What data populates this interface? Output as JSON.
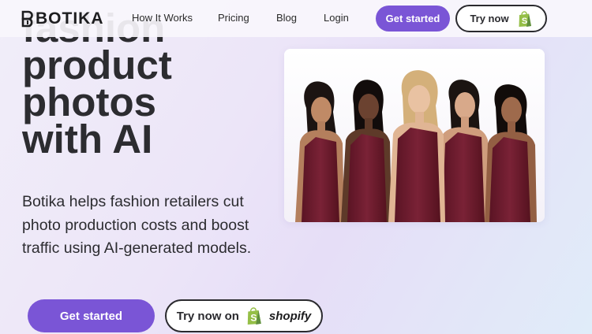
{
  "header": {
    "logo_text": "BOTIKA",
    "nav": [
      {
        "label": "How It Works"
      },
      {
        "label": "Pricing"
      },
      {
        "label": "Blog"
      },
      {
        "label": "Login"
      }
    ],
    "get_started_label": "Get started",
    "try_now_label": "Try now"
  },
  "hero": {
    "title_lines": [
      "fashion",
      "product",
      "photos",
      "with AI"
    ],
    "subtitle": "Botika helps fashion retailers cut photo production costs and boost traffic using AI-generated models.",
    "get_started_label": "Get started",
    "try_now_label": "Try now on",
    "shopify_label": "shopify"
  },
  "colors": {
    "accent": "#7a55d6",
    "text": "#2c2c30",
    "dress": "#6e1a2c",
    "shopify_green": "#95bf47"
  },
  "icons": {
    "logo": "botika-logo-icon",
    "shopify": "shopify-bag-icon"
  }
}
